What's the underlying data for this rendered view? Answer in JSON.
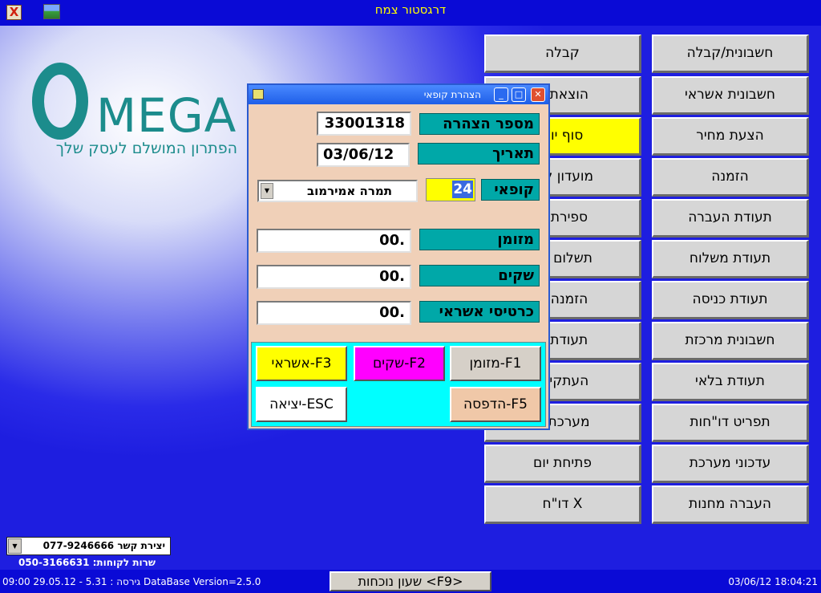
{
  "window": {
    "title": "דרגסטור צמח",
    "close_glyph": "X"
  },
  "logo": {
    "big_letter": "O",
    "rest": "MEGA",
    "tagline": "הפתרון המושלם לעסק שלך"
  },
  "menu": {
    "right_column": [
      "חשבונית/קבלה",
      "חשבונית אשראי",
      "הצעת מחיר",
      "הזמנה",
      "תעודת העברה",
      "תעודת משלוח",
      "תעודת כניסה",
      "חשבונית מרכזת",
      "תעודת בלאי",
      "תפריט דו\"חות",
      "עדכוני מערכת",
      "העברה מחנות"
    ],
    "left_column": [
      "קבלה",
      "הוצאת ה",
      "סוף יום",
      "מועדון לקו",
      "ספירת מ",
      "תשלום לס",
      "הזמנה מ",
      "תעודת ה",
      "העתקי ת",
      "מערכת ע",
      "פתיחת יום",
      "X דו\"ח"
    ]
  },
  "dialog": {
    "title": "הצהרת קופאי",
    "declaration_number_label": "מספר הצהרה",
    "declaration_number": "33001318",
    "date_label": "תאריך",
    "date": "03/06/12",
    "cashier_label": "קופאי",
    "cashier_number": "24",
    "cashier_name": "תמרה אמירמוב",
    "cash_label": "מזומן",
    "cash_value": "00.",
    "checks_label": "שקים",
    "checks_value": "00.",
    "credit_label": "כרטיסי אשראי",
    "credit_value": "00.",
    "fkeys": {
      "f1": "F1-מזומן",
      "f2": "F2-שקים",
      "f3": "F3-אשראי",
      "f5": "F5-הדפסה",
      "esc": "ESC-יציאה"
    },
    "colors": {
      "f1": "#d6d0c8",
      "f2": "#ff00ff",
      "f3": "#ffff00",
      "f5": "#f0c8a8",
      "esc": "#ffffff"
    }
  },
  "contact": {
    "select_value": "יצירת קשר 077-9246666",
    "service": "שרות לקוחות: 050-3166631"
  },
  "status": {
    "left": "09:00 29.05.12 - 5.31 : גירסה DataBase Version=2.5.0",
    "clock_button": "שעון נוכחות <F9>",
    "right": "03/06/12 18:04:21"
  }
}
